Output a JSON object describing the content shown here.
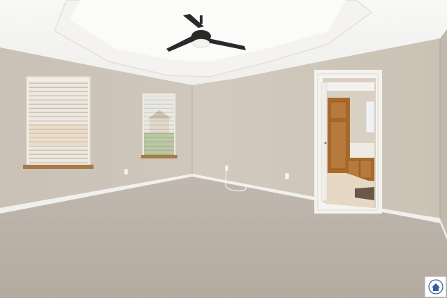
{
  "scene": {
    "kind": "photo",
    "subject": "empty room",
    "colors": {
      "wall": "#ccc3b8",
      "wall_shadow": "#bcb3a8",
      "ceiling": "#f6f5f3",
      "carpet": "#b9b0a6",
      "trim": "#f3f2ee",
      "fan": "#2a2a2a",
      "blind": "#ebe7df",
      "sill": "#a87a48",
      "cabinet": "#a8692d",
      "tile": "#e6d8c4",
      "rug": "#6b5648",
      "sky": "#dfe7ee",
      "lawn": "#7fa15e"
    }
  },
  "watermark": {
    "icon": "house-logo-icon",
    "color": "#2f5f95"
  }
}
